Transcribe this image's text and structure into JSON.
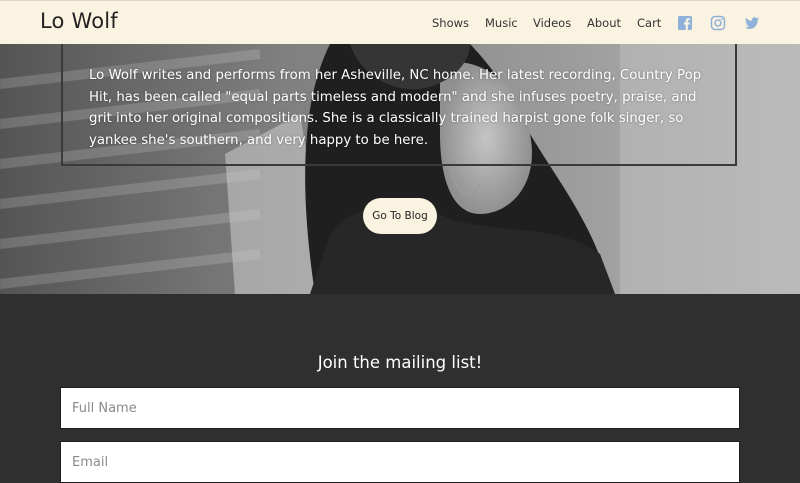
{
  "header": {
    "brand": "Lo Wolf",
    "nav": [
      "Shows",
      "Music",
      "Videos",
      "About",
      "Cart"
    ],
    "social_icons": [
      "facebook-icon",
      "instagram-icon",
      "twitter-icon"
    ],
    "icon_color": "#8fb0d8",
    "background": "#fbf3e1"
  },
  "hero": {
    "bio": "Lo Wolf writes and performs from her Asheville, NC home. Her latest recording, Country Pop Hit, has been called \"equal parts timeless and modern\" and she infuses poetry, praise, and grit into her original compositions. She is a classically trained harpist gone folk singer, so yankee she's southern, and very happy to be here.",
    "button_label": "Go To Blog"
  },
  "mailing": {
    "title": "Join the mailing list!",
    "name_placeholder": "Full Name",
    "email_placeholder": "Email"
  }
}
